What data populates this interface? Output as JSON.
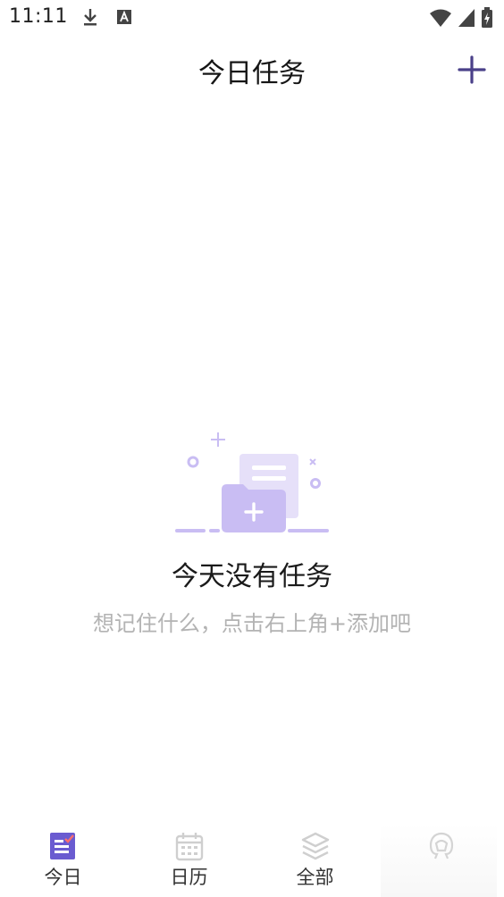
{
  "status_bar": {
    "time": "11:11",
    "left_icons": [
      "download-icon",
      "font-app-icon"
    ],
    "right_icons": [
      "wifi-icon",
      "signal-icon",
      "battery-charging-icon"
    ]
  },
  "header": {
    "title": "今日任务",
    "add_icon": "plus-icon",
    "accent_color": "#4a4089"
  },
  "empty_state": {
    "title": "今天没有任务",
    "hint": "想记住什么，点击右上角+添加吧",
    "illustration_icon": "empty-folder-illustration",
    "illustration_color": "#c9bdf3"
  },
  "bottom_nav": {
    "items": [
      {
        "label": "今日",
        "icon": "today-icon",
        "active": true
      },
      {
        "label": "日历",
        "icon": "calendar-icon",
        "active": false
      },
      {
        "label": "全部",
        "icon": "layers-icon",
        "active": false
      },
      {
        "label": "",
        "icon": "mine-icon",
        "active": false
      }
    ],
    "active_color": "#6a5bd0",
    "inactive_color": "#cfcfcf"
  }
}
